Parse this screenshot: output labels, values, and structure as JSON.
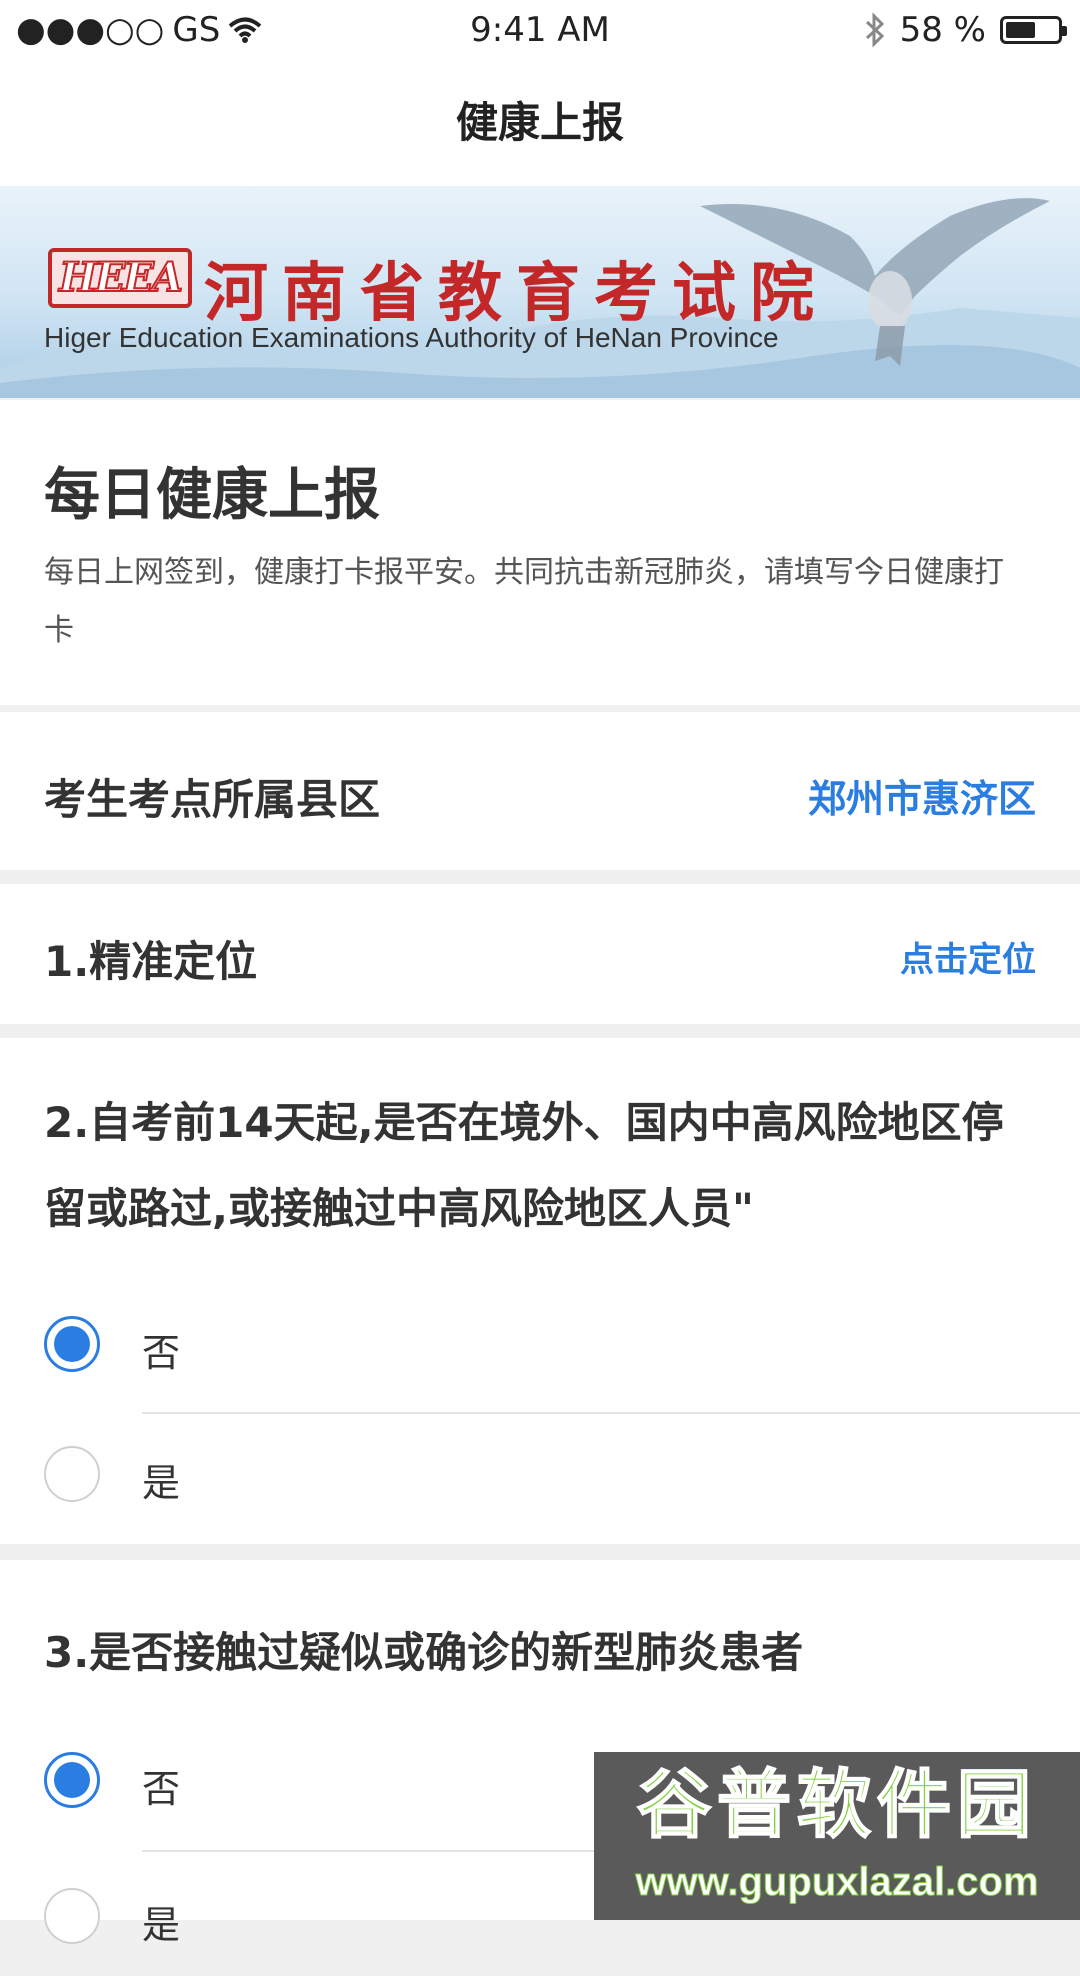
{
  "status_bar": {
    "signal": "●●●○○",
    "carrier": "GS",
    "time": "9:41 AM",
    "battery_text": "58 %",
    "battery_level": 0.58
  },
  "nav": {
    "title": "健康上报"
  },
  "banner": {
    "logo_text": "HEEA",
    "name_cn": "河南省教育考试院",
    "name_en": "Higer Education Examinations Authority of HeNan Province"
  },
  "intro": {
    "heading": "每日健康上报",
    "description": "每日上网签到，健康打卡报平安。共同抗击新冠肺炎，请填写今日健康打卡"
  },
  "district_row": {
    "label": "考生考点所属县区",
    "value": "郑州市惠济区"
  },
  "location_row": {
    "label": "1.精准定位",
    "action": "点击定位"
  },
  "questions": [
    {
      "title": "2.自考前14天起,是否在境外、国内中高风险地区停留或路过,或接触过中高风险地区人员\"",
      "options": [
        {
          "label": "否",
          "selected": true
        },
        {
          "label": "是",
          "selected": false
        }
      ]
    },
    {
      "title": "3.是否接触过疑似或确诊的新型肺炎患者",
      "options": [
        {
          "label": "否",
          "selected": true
        },
        {
          "label": "是",
          "selected": false
        }
      ]
    }
  ],
  "watermark": {
    "brand": "谷普软件园",
    "url": "www.gupuxlazal.com"
  },
  "colors": {
    "accent": "#2a7de1",
    "banner_red": "#c42727",
    "background": "#f0f0f0"
  },
  "icons": [
    "wifi-icon",
    "bluetooth-icon",
    "battery-icon",
    "eagle-image"
  ]
}
